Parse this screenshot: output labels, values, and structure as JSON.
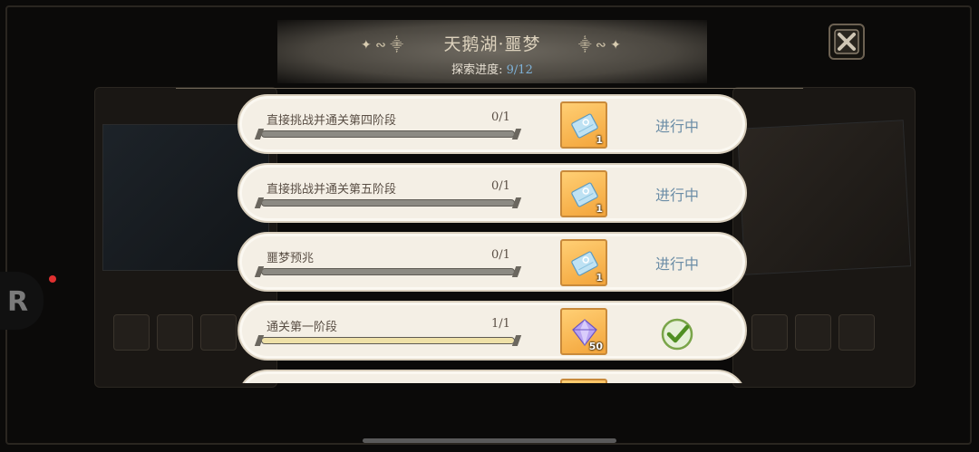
{
  "header": {
    "title": "天鹅湖·噩梦",
    "progress_label": "探索进度: ",
    "progress_value": "9/12"
  },
  "quests": [
    {
      "name": "直接挑战并通关第四阶段",
      "count": "0/1",
      "progress": 0,
      "reward": {
        "icon": "ticket-icon",
        "qty": "1"
      },
      "status": "进行中"
    },
    {
      "name": "直接挑战并通关第五阶段",
      "count": "0/1",
      "progress": 0,
      "reward": {
        "icon": "ticket-icon",
        "qty": "1"
      },
      "status": "进行中"
    },
    {
      "name": "噩梦预兆",
      "count": "0/1",
      "progress": 0,
      "reward": {
        "icon": "ticket-icon",
        "qty": "1"
      },
      "status": "进行中"
    },
    {
      "name": "通关第一阶段",
      "count": "1/1",
      "progress": 1,
      "reward": {
        "icon": "crystal-icon",
        "qty": "50"
      },
      "status": "completed",
      "status_icon": "check-icon"
    }
  ],
  "colors": {
    "status_text": "#6b8da6",
    "progress_value": "#7fb2d8",
    "bar_fill": "#efe1a8",
    "check": "#5a9a2a"
  }
}
